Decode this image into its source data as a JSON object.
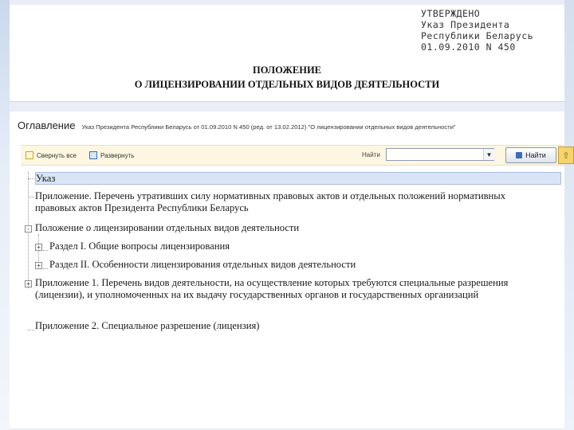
{
  "document": {
    "approval": [
      "УТВЕРЖДЕНО",
      "Указ Президента",
      "Республики Беларусь",
      "01.09.2010 N 450"
    ],
    "title_line1": "ПОЛОЖЕНИЕ",
    "title_line2": "О ЛИЦЕНЗИРОВАНИИ ОТДЕЛЬНЫХ ВИДОВ ДЕЯТЕЛЬНОСТИ"
  },
  "viewer": {
    "toc_label": "Оглавление",
    "decree_title": "Указ Президента Республики Беларусь от 01.09.2010 N 450 (ред. от 13.02.2012) \"О лицензировании отдельных видов деятельности\"",
    "toolbar": {
      "collapse_all": "Свернуть все",
      "expand": "Развернуть",
      "find_label": "Найти",
      "find_button": "Найти",
      "find_value": ""
    },
    "tree": [
      {
        "label": "Указ"
      },
      {
        "label": "Приложение. Перечень утративших силу нормативных правовых актов и отдельных положений нормативных правовых актов Президента Республики Беларусь"
      },
      {
        "label": "Положение о лицензировании отдельных видов деятельности"
      },
      {
        "label": "Раздел I. Общие вопросы лицензирования"
      },
      {
        "label": "Раздел II. Особенности лицензирования отдельных видов деятельности"
      },
      {
        "label": "Приложение 1. Перечень видов деятельности, на осуществление которых требуются специальные разрешения (лицензии), и уполномоченных на их выдачу государственных органов и государственных организаций"
      },
      {
        "label": "Приложение 2. Специальное разрешение (лицензия)"
      }
    ]
  },
  "colors": {
    "toolbar_bg": "#fdf6e0",
    "selected_bg": "#d9e4f7",
    "page_bg": "#e9eef5"
  },
  "icons": {
    "collapse": "collapse-all-icon",
    "expand": "expand-icon",
    "find": "find-icon",
    "up": "arrow-up-icon",
    "tree_toggle": "plus-minus-icon"
  }
}
